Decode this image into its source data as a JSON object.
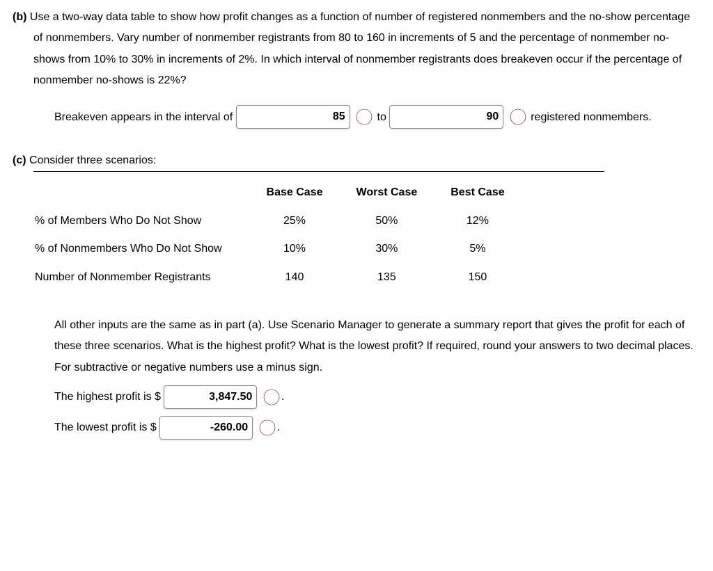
{
  "partB": {
    "label": "(b)",
    "prompt": "Use a two-way data table to show how profit changes as a function of number of registered nonmembers and the no-show percentage of nonmembers. Vary number of nonmember registrants from 80 to 160 in increments of 5 and the percentage of nonmember no-shows from 10% to 30% in increments of 2%. In which interval of nonmember registrants does breakeven occur if the percentage of nonmember no-shows is 22%?",
    "ans_pre": "Breakeven appears in the interval of",
    "val1": "85",
    "to": "to",
    "val2": "90",
    "ans_post": "registered nonmembers."
  },
  "partC": {
    "label": "(c)",
    "intro": "Consider three scenarios:",
    "table": {
      "headers": [
        "",
        "Base Case",
        "Worst Case",
        "Best Case"
      ],
      "rows": [
        {
          "label": "% of Members Who Do Not Show",
          "base": "25%",
          "worst": "50%",
          "best": "12%"
        },
        {
          "label": "% of Nonmembers Who Do Not Show",
          "base": "10%",
          "worst": "30%",
          "best": "5%"
        },
        {
          "label": "Number of Nonmember Registrants",
          "base": "140",
          "worst": "135",
          "best": "150"
        }
      ]
    },
    "post": "All other inputs are the same as in part (a). Use Scenario Manager to generate a summary report that gives the profit for each of these three scenarios. What is the highest profit? What is the lowest profit? If required, round your answers to two decimal places. For subtractive or negative numbers use a minus sign.",
    "highest_pre": "The highest profit is $",
    "highest_val": "3,847.50",
    "lowest_pre": "The lowest profit is $",
    "lowest_val": "-260.00",
    "period": "."
  }
}
